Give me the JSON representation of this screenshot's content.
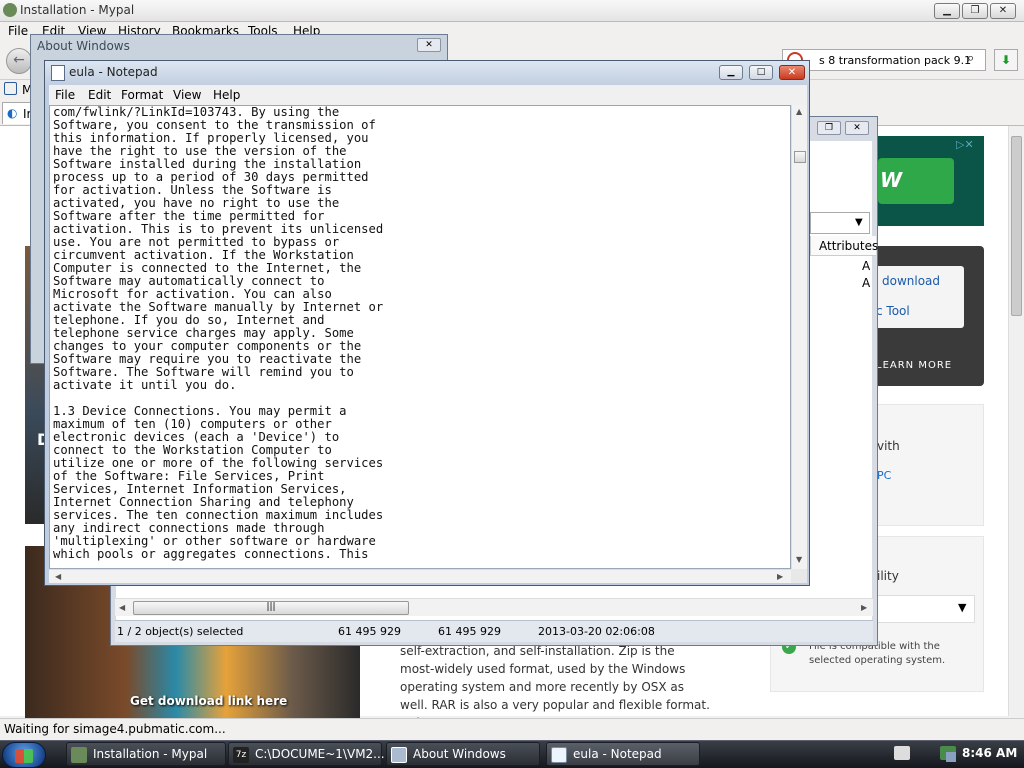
{
  "browser": {
    "title": "Installation - Mypal",
    "menu": [
      "File",
      "Edit",
      "View",
      "History",
      "Bookmarks",
      "Tools",
      "Help"
    ],
    "search_text": "s 8 transformation pack 9.1",
    "bookmark_label": "M",
    "tab_label": "Ir",
    "status": "Waiting for simage4.pubmatic.com..."
  },
  "page": {
    "ad_letter": "W",
    "ad_download": "download",
    "ad_tool": "c Tool",
    "learn_more": "LEARN MORE",
    "side_with": "vith",
    "side_pc": "PC",
    "side_ility": "ility",
    "compat_line1": "File is compatible with the",
    "compat_line2": "selected operating system.",
    "left_letter": "D",
    "game_caption": "Get download link here",
    "article": "self-extraction, and self-installation. Zip is the most-widely used format, used by the Windows operating system and more recently by OSX as well. RAR is also a very popular and flexible format. Unix"
  },
  "explorer": {
    "attributes_header": "Attributes",
    "attr_values": [
      "A",
      "A"
    ],
    "status_selected": "1 / 2 object(s) selected",
    "status_size1": "61 495 929",
    "status_size2": "61 495 929",
    "status_date": "2013-03-20 02:06:08"
  },
  "about": {
    "title": "About Windows"
  },
  "notepad": {
    "title": "eula - Notepad",
    "menu": [
      "File",
      "Edit",
      "Format",
      "View",
      "Help"
    ],
    "text": "com/fwlink/?LinkId=103743. By using the\nSoftware, you consent to the transmission of\nthis information. If properly licensed, you\nhave the right to use the version of the\nSoftware installed during the installation\nprocess up to a period of 30 days permitted\nfor activation. Unless the Software is\nactivated, you have no right to use the\nSoftware after the time permitted for\nactivation. This is to prevent its unlicensed\nuse. You are not permitted to bypass or\ncircumvent activation. If the Workstation\nComputer is connected to the Internet, the\nSoftware may automatically connect to\nMicrosoft for activation. You can also\nactivate the Software manually by Internet or\ntelephone. If you do so, Internet and\ntelephone service charges may apply. Some\nchanges to your computer components or the\nSoftware may require you to reactivate the\nSoftware. The Software will remind you to\nactivate it until you do.\n\n1.3 Device Connections. You may permit a\nmaximum of ten (10) computers or other\nelectronic devices (each a 'Device') to\nconnect to the Workstation Computer to\nutilize one or more of the following services\nof the Software: File Services, Print\nServices, Internet Information Services,\nInternet Connection Sharing and telephony\nservices. The ten connection maximum includes\nany indirect connections made through\n'multiplexing' or other software or hardware\nwhich pools or aggregates connections. This"
  },
  "taskbar": {
    "items": [
      "Installation - Mypal",
      "C:\\DOCUME~1\\VM2...",
      "About Windows",
      "eula - Notepad"
    ],
    "time": "8:46 AM"
  }
}
